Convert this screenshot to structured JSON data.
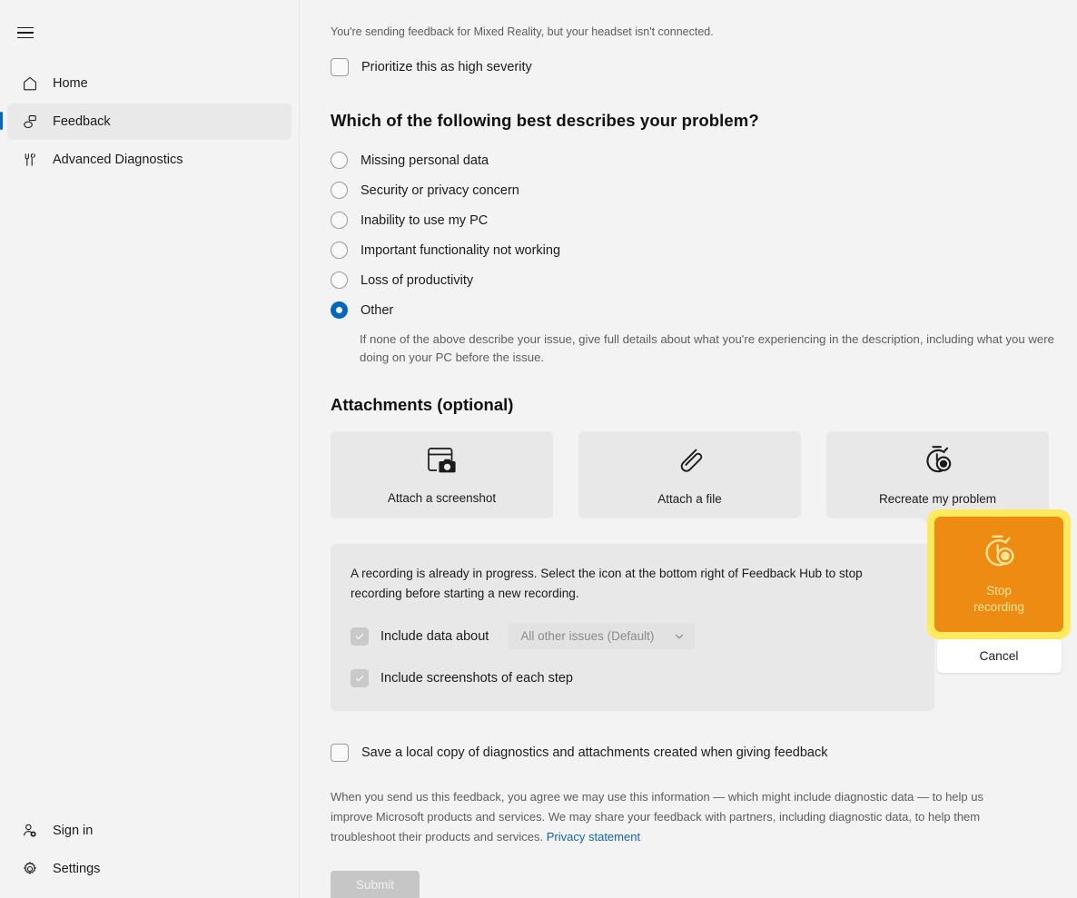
{
  "sidebar": {
    "menu_icon": "hamburger-icon",
    "items": [
      {
        "label": "Home",
        "icon": "home-icon"
      },
      {
        "label": "Feedback",
        "icon": "feedback-icon"
      },
      {
        "label": "Advanced Diagnostics",
        "icon": "diagnostics-icon"
      }
    ],
    "bottom_items": [
      {
        "label": "Sign in",
        "icon": "person-add-icon"
      },
      {
        "label": "Settings",
        "icon": "gear-icon"
      }
    ]
  },
  "main": {
    "notice": "You're sending feedback for Mixed Reality, but your headset isn't connected.",
    "priority_checkbox_label": "Prioritize this as high severity",
    "problem_heading": "Which of the following best describes your problem?",
    "problem_options": [
      {
        "label": "Missing personal data",
        "selected": false
      },
      {
        "label": "Security or privacy concern",
        "selected": false
      },
      {
        "label": "Inability to use my PC",
        "selected": false
      },
      {
        "label": "Important functionality not working",
        "selected": false
      },
      {
        "label": "Loss of productivity",
        "selected": false
      },
      {
        "label": "Other",
        "selected": true
      }
    ],
    "other_help": "If none of the above describe your issue, give full details about what you're experiencing in the description, including what you were doing on your PC before the issue.",
    "attachments_heading": "Attachments (optional)",
    "attachment_cards": [
      {
        "label": "Attach a screenshot",
        "icon": "screenshot-icon"
      },
      {
        "label": "Attach a file",
        "icon": "paperclip-icon"
      },
      {
        "label": "Recreate my problem",
        "icon": "stopwatch-record-icon"
      }
    ],
    "recording_panel": {
      "message": "A recording is already in progress. Select the icon at the bottom right of Feedback Hub to stop recording before starting a new recording.",
      "include_data_label": "Include data about",
      "include_data_checked": true,
      "dropdown_value": "All other issues (Default)",
      "dropdown_icon": "chevron-down-icon",
      "include_screenshots_label": "Include screenshots of each step",
      "include_screenshots_checked": true
    },
    "flyout": {
      "stop_label_line1": "Stop",
      "stop_label_line2": "recording",
      "stop_icon": "stopwatch-record-icon",
      "cancel_label": "Cancel",
      "highlight_color": "#FFE95C",
      "button_color": "#EE8B12"
    },
    "save_copy_label": "Save a local copy of diagnostics and attachments created when giving feedback",
    "legal_text": "When you send us this feedback, you agree we may use this information — which might include diagnostic data — to help us improve Microsoft products and services. We may share your feedback with partners, including diagnostic data, to help them troubleshoot their products and services. ",
    "privacy_link": "Privacy statement",
    "submit_label": "Submit"
  }
}
